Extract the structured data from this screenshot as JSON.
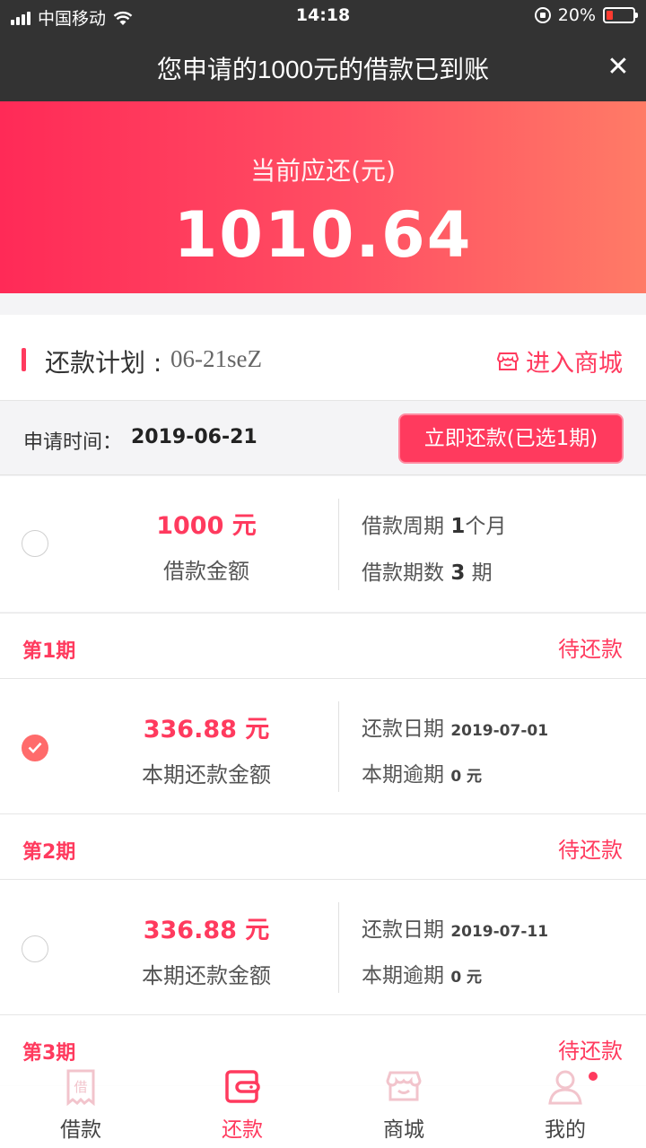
{
  "status_bar": {
    "carrier": "中国移动",
    "time": "14:18",
    "battery": "20%"
  },
  "notification": {
    "message": "您申请的1000元的借款已到账",
    "close": "✕"
  },
  "hero": {
    "label": "当前应还(元)",
    "amount": "1010.64"
  },
  "plan": {
    "title": "还款计划 :",
    "code": "06-21seZ",
    "shop_link": "进入商城",
    "apply_label": "申请时间：",
    "apply_date": "2019-06-21",
    "repay_button": "立即还款(已选1期)"
  },
  "loan": {
    "amount": "1000 元",
    "amount_label": "借款金额",
    "cycle_label": "借款周期",
    "cycle_value": "1",
    "cycle_unit": "个月",
    "count_label": "借款期数",
    "count_value": "3",
    "count_unit": "期"
  },
  "periods": [
    {
      "name": "第1期",
      "status": "待还款",
      "amount": "336.88 元",
      "amount_label": "本期还款金额",
      "date_label": "还款日期",
      "date": "2019-07-01",
      "overdue_label": "本期逾期",
      "overdue": "0 元",
      "checked": true
    },
    {
      "name": "第2期",
      "status": "待还款",
      "amount": "336.88 元",
      "amount_label": "本期还款金额",
      "date_label": "还款日期",
      "date": "2019-07-11",
      "overdue_label": "本期逾期",
      "overdue": "0 元",
      "checked": false
    },
    {
      "name": "第3期",
      "status": "待还款"
    }
  ],
  "tabbar": {
    "items": [
      {
        "label": "借款",
        "icon": "loan-icon"
      },
      {
        "label": "还款",
        "icon": "wallet-icon"
      },
      {
        "label": "商城",
        "icon": "store-icon"
      },
      {
        "label": "我的",
        "icon": "user-icon"
      }
    ],
    "active_index": 1
  },
  "colors": {
    "accent": "#ff3a5e",
    "dark_bar": "#333333",
    "gradient_start": "#ff2a57",
    "gradient_end": "#ff7b66"
  }
}
